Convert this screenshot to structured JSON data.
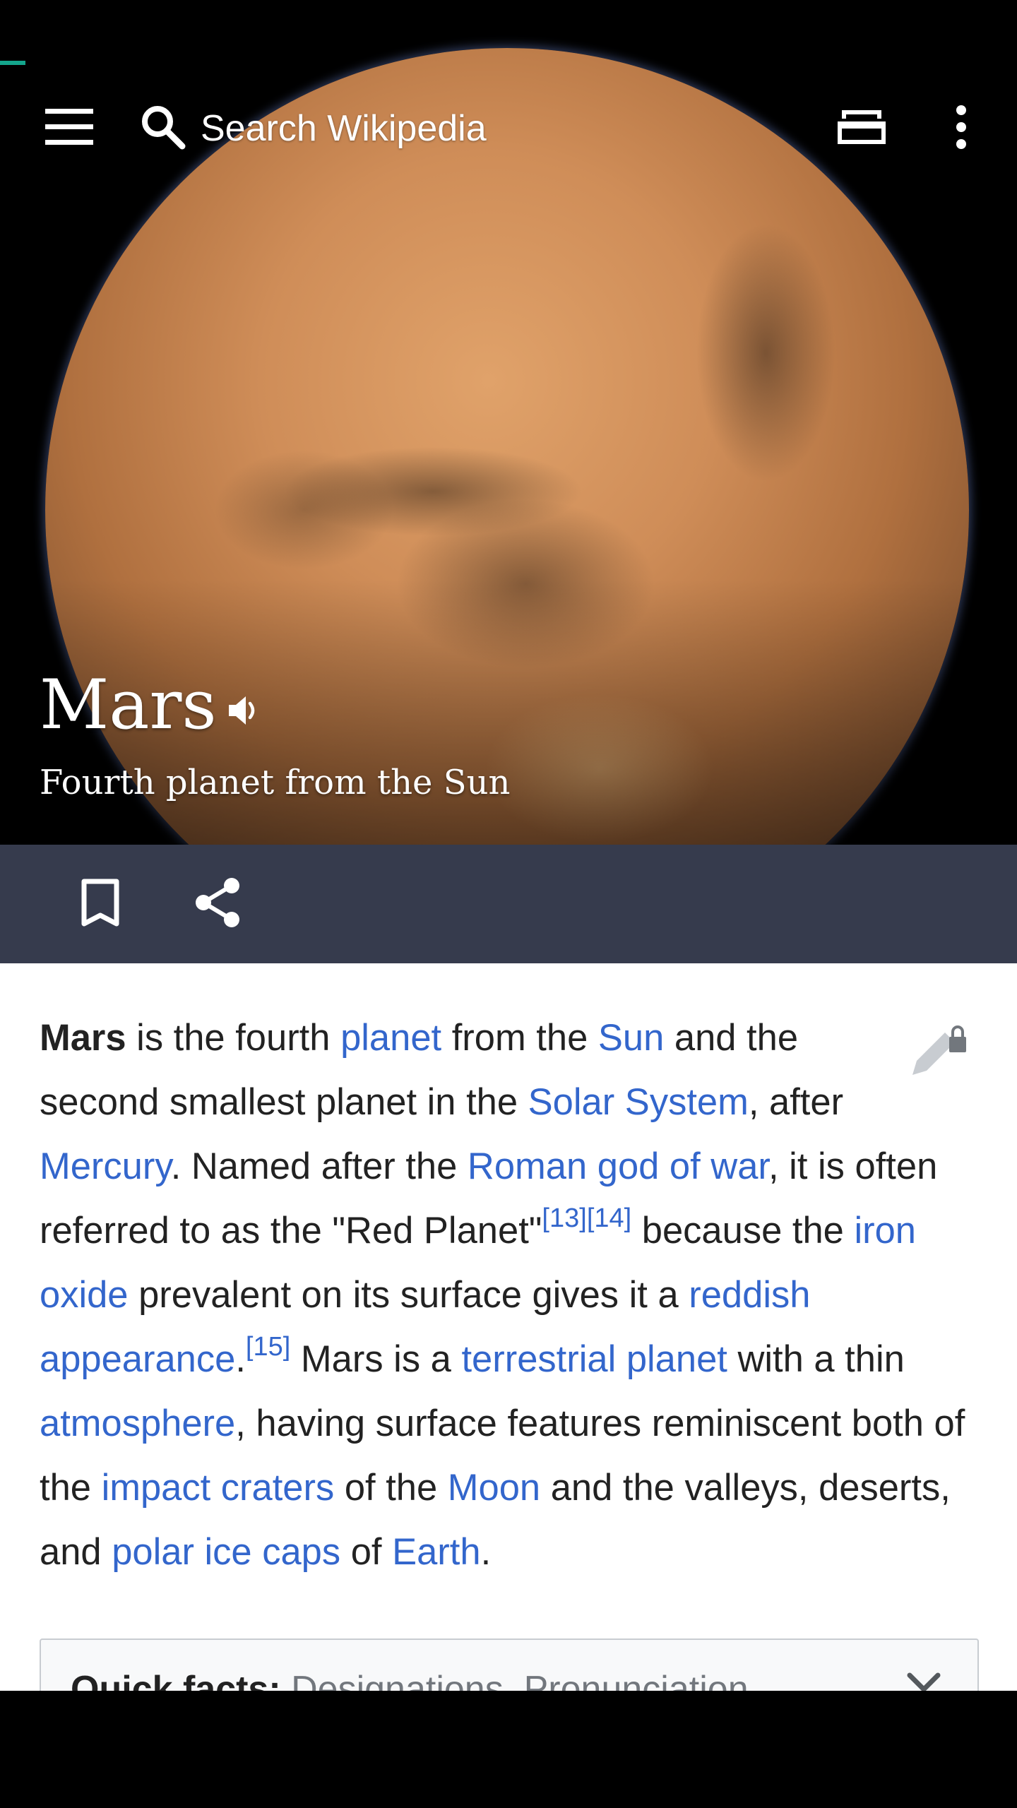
{
  "app": {
    "accent_color": "#14a58c",
    "action_bar_color": "#363b4d",
    "link_color": "#3366cc"
  },
  "toolbar": {
    "menu_icon": "hamburger-menu-icon",
    "search_icon": "search-icon",
    "search_placeholder": "Search Wikipedia",
    "tabs_icon": "tabs-icon",
    "overflow_icon": "more-vert-icon"
  },
  "article": {
    "title": "Mars",
    "subtitle": "Fourth planet from the Sun",
    "pronunciation_icon": "speaker-icon"
  },
  "actions": {
    "bookmark_icon": "bookmark-icon",
    "share_icon": "share-icon"
  },
  "lead": {
    "edit_icon": "edit-locked-icon",
    "t01_bold": "Mars",
    "t02": " is the fourth ",
    "t03_link": "planet",
    "t04": " from the ",
    "t05_link": "Sun",
    "t06": " and the second smallest planet in the ",
    "t07_link": "Solar System",
    "t08": ", after ",
    "t09_link": "Mercury",
    "t10": ". Named after the ",
    "t11_link": "Roman god of war",
    "t12": ", it is often referred to as the \"Red Planet\"",
    "t13_ref": "[13]",
    "t14_ref": "[14]",
    "t15": " because the ",
    "t16_link": "iron oxide",
    "t17": " prevalent on its surface gives it a ",
    "t18_link": "reddish appearance",
    "t19": ".",
    "t20_ref": "[15]",
    "t21": " Mars is a ",
    "t22_link": "terrestrial planet",
    "t23": " with a thin ",
    "t24_link": "atmosphere",
    "t25": ", having surface features reminiscent both of the ",
    "t26_link": "impact craters",
    "t27": " of the ",
    "t28_link": "Moon",
    "t29": " and the valleys, deserts, and ",
    "t30_link": "polar ice caps",
    "t31": " of ",
    "t32_link": "Earth",
    "t33": "."
  },
  "quick_facts": {
    "label": "Quick facts:",
    "items": " Designations, Pronunciation...",
    "chevron_icon": "chevron-down-icon"
  }
}
